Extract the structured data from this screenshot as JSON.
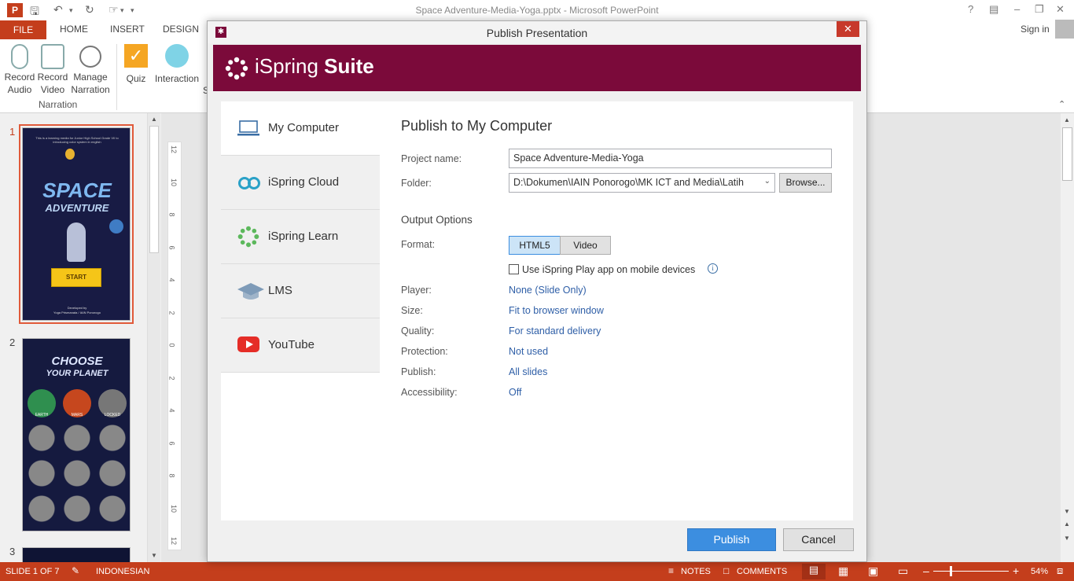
{
  "window": {
    "title": "Space Adventure-Media-Yoga.pptx - Microsoft PowerPoint",
    "sign_in": "Sign in"
  },
  "ribbon": {
    "tabs": [
      "FILE",
      "HOME",
      "INSERT",
      "DESIGN"
    ],
    "buttons": {
      "record_audio": [
        "Record",
        "Audio"
      ],
      "record_video": [
        "Record",
        "Video"
      ],
      "manage_narration": [
        "Manage",
        "Narration"
      ],
      "quiz": "Quiz",
      "interaction": "Interaction",
      "group_narration": "Narration",
      "cut_letter": "S"
    }
  },
  "slides": {
    "numbers": [
      "1",
      "2",
      "3"
    ],
    "slide1": {
      "caption": "This is a learning media for Junior High School Grade VII to introducing color system in english",
      "title_line1": "SPACE",
      "title_line2": "ADVENTURE",
      "start": "START",
      "footer1": "Developed by",
      "footer2": "Yoga Prismanata / IAIN Ponorogo"
    },
    "slide2": {
      "title_line1": "CHOOSE",
      "title_line2": "YOUR PLANET",
      "planets": [
        "EARTH",
        "MARS",
        "LOCKED"
      ]
    }
  },
  "ruler_labels": [
    "12",
    "10",
    "8",
    "6",
    "4",
    "2",
    "0",
    "2",
    "4",
    "6",
    "8",
    "10",
    "12"
  ],
  "status": {
    "slide": "SLIDE 1 OF 7",
    "language": "INDONESIAN",
    "notes": "NOTES",
    "comments": "COMMENTS",
    "zoom": "54%"
  },
  "dialog": {
    "title": "Publish Presentation",
    "brand_light": "iSpring ",
    "brand_bold": "Suite",
    "nav": [
      {
        "label": "My Computer",
        "icon": "laptop-icon"
      },
      {
        "label": "iSpring Cloud",
        "icon": "cloud-icon"
      },
      {
        "label": "iSpring Learn",
        "icon": "ispring-learn-icon"
      },
      {
        "label": "LMS",
        "icon": "graduation-cap-icon"
      },
      {
        "label": "YouTube",
        "icon": "youtube-icon"
      }
    ],
    "heading": "Publish to My Computer",
    "project_name_label": "Project name:",
    "project_name_value": "Space Adventure-Media-Yoga",
    "folder_label": "Folder:",
    "folder_value": "D:\\Dokumen\\IAIN Ponorogo\\MK ICT and Media\\Latih",
    "browse": "Browse...",
    "output_options": "Output Options",
    "format_label": "Format:",
    "format_options": [
      "HTML5",
      "Video"
    ],
    "format_selected": "HTML5",
    "mobile_checkbox": "Use iSpring Play app on mobile devices",
    "mobile_checked": false,
    "settings": [
      {
        "label": "Player:",
        "value": "None (Slide Only)"
      },
      {
        "label": "Size:",
        "value": "Fit to browser window"
      },
      {
        "label": "Quality:",
        "value": "For standard delivery"
      },
      {
        "label": "Protection:",
        "value": "Not used"
      },
      {
        "label": "Publish:",
        "value": "All slides"
      },
      {
        "label": "Accessibility:",
        "value": "Off"
      }
    ],
    "publish": "Publish",
    "cancel": "Cancel"
  },
  "colors": {
    "accent": "#c43e1c",
    "brand": "#7b0a3a",
    "link": "#2f5fa7",
    "primary_button": "#3c8ee0"
  }
}
